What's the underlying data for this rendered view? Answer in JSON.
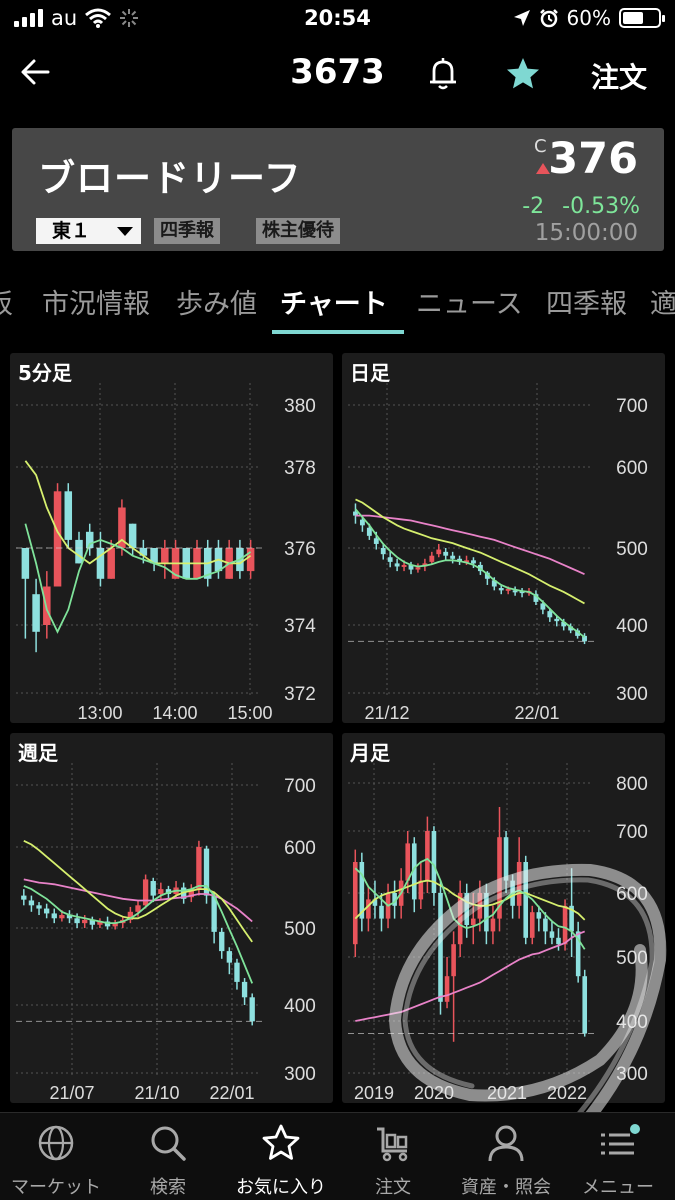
{
  "status_bar": {
    "carrier": "au",
    "time": "20:54",
    "battery": "60%",
    "battery_level": 0.6
  },
  "nav": {
    "code": "3673",
    "order_label": "注文"
  },
  "stock": {
    "name": "ブロードリーフ",
    "market": "東１",
    "tags": [
      "四季報",
      "株主優待"
    ],
    "price_flag": "C",
    "price": "376",
    "change": "-2",
    "change_pct": "-0.53%",
    "time": "15:00:00"
  },
  "tabs": [
    "板",
    "市況情報",
    "歩み値",
    "チャート",
    "ニュース",
    "四季報",
    "適"
  ],
  "active_tab": 3,
  "colors": {
    "accent": "#7fd8d2",
    "up": "#e8545b",
    "down": "#8ee0df",
    "ma_short": "#7fe39a",
    "ma_mid": "#d6ef6e",
    "ma_long": "#e882c8",
    "change": "#7ee69a"
  },
  "chart_data": [
    {
      "type": "candlestick",
      "title": "5分足",
      "y_ticks": [
        380,
        378,
        376,
        374,
        372
      ],
      "ylim": [
        372,
        380
      ],
      "x_ticks": [
        "13:00",
        "14:00",
        "15:00"
      ],
      "last_price": 376,
      "candles": [
        [
          376,
          375.2,
          376,
          373.6
        ],
        [
          374.8,
          373.8,
          375.2,
          373.2
        ],
        [
          374,
          375,
          375.4,
          373.6
        ],
        [
          375,
          377.4,
          377.6,
          375
        ],
        [
          377.4,
          376.2,
          377.6,
          376
        ],
        [
          376.2,
          375.6,
          376.4,
          375.6
        ],
        [
          376.4,
          376,
          376.6,
          375.8
        ],
        [
          376,
          375.2,
          376.4,
          375
        ],
        [
          375.2,
          376,
          376.2,
          375.2
        ],
        [
          376,
          377,
          377.2,
          375.8
        ],
        [
          376.6,
          376,
          376.6,
          375.8
        ],
        [
          376,
          375.8,
          376.2,
          375.6
        ],
        [
          376,
          375.6,
          376,
          375.4
        ],
        [
          375.6,
          376,
          376.2,
          375.2
        ],
        [
          375.2,
          376,
          376.2,
          375.2
        ],
        [
          376,
          375.2,
          376,
          375.2
        ],
        [
          375.2,
          376,
          376.2,
          375.2
        ],
        [
          376,
          375.2,
          376.2,
          375
        ],
        [
          376,
          375.4,
          376.2,
          375.2
        ],
        [
          375.2,
          376,
          376.2,
          375.2
        ],
        [
          376,
          375.4,
          376.2,
          375.2
        ],
        [
          375.4,
          376,
          376.2,
          375.2
        ]
      ],
      "ma": [
        {
          "color": "#d6ef6e",
          "values": [
            378.2,
            377.8,
            377,
            376.4,
            376,
            375.8,
            375.6,
            375.8,
            376,
            376.2,
            376,
            375.8,
            375.6,
            375.6,
            375.6,
            375.6,
            375.6,
            375.6,
            375.7,
            375.6,
            375.6,
            375.8
          ]
        },
        {
          "color": "#7fe39a",
          "values": [
            376.6,
            375.6,
            374.4,
            373.8,
            374.4,
            375.4,
            376.1,
            376.2,
            376.1,
            376,
            375.8,
            375.7,
            375.6,
            375.5,
            375.3,
            375.2,
            375.2,
            375.3,
            375.4,
            375.6,
            375.7,
            375.9
          ]
        }
      ]
    },
    {
      "type": "candlestick",
      "title": "日足",
      "y_ticks": [
        700,
        600,
        500,
        400,
        300
      ],
      "ylim": [
        300,
        700
      ],
      "x_ticks": [
        "21/12",
        "22/01"
      ],
      "last_price": 376,
      "candles": [
        [
          545,
          540,
          555,
          530
        ],
        [
          535,
          528,
          540,
          520
        ],
        [
          525,
          515,
          530,
          510
        ],
        [
          512,
          505,
          520,
          498
        ],
        [
          500,
          492,
          505,
          485
        ],
        [
          488,
          482,
          495,
          475
        ],
        [
          480,
          476,
          486,
          470
        ],
        [
          476,
          478,
          484,
          470
        ],
        [
          478,
          472,
          482,
          466
        ],
        [
          472,
          475,
          480,
          468
        ],
        [
          476,
          480,
          486,
          470
        ],
        [
          482,
          490,
          495,
          478
        ],
        [
          492,
          498,
          505,
          488
        ],
        [
          495,
          490,
          500,
          484
        ],
        [
          490,
          486,
          495,
          480
        ],
        [
          486,
          482,
          490,
          478
        ],
        [
          482,
          484,
          490,
          478
        ],
        [
          484,
          480,
          488,
          474
        ],
        [
          478,
          470,
          482,
          465
        ],
        [
          468,
          460,
          470,
          452
        ],
        [
          458,
          450,
          462,
          445
        ],
        [
          448,
          445,
          452,
          440
        ],
        [
          446,
          447,
          450,
          440
        ],
        [
          445,
          444,
          450,
          438
        ],
        [
          444,
          442,
          448,
          436
        ],
        [
          442,
          444,
          448,
          438
        ],
        [
          440,
          430,
          445,
          426
        ],
        [
          428,
          420,
          432,
          414
        ],
        [
          418,
          410,
          422,
          404
        ],
        [
          408,
          405,
          412,
          398
        ],
        [
          404,
          398,
          408,
          392
        ],
        [
          398,
          392,
          402,
          388
        ],
        [
          392,
          384,
          395,
          380
        ],
        [
          384,
          376,
          388,
          372
        ]
      ],
      "ma": [
        {
          "color": "#e882c8",
          "values": [
            540,
            540,
            540,
            539,
            538,
            537,
            536,
            535,
            534,
            532,
            530,
            528,
            526,
            524,
            522,
            520,
            518,
            516,
            514,
            512,
            510,
            507,
            504,
            501,
            498,
            495,
            492,
            489,
            486,
            482,
            478,
            474,
            470,
            466
          ]
        },
        {
          "color": "#d6ef6e",
          "values": [
            560,
            556,
            550,
            544,
            538,
            533,
            528,
            524,
            521,
            518,
            515,
            512,
            510,
            508,
            506,
            503,
            500,
            497,
            494,
            490,
            486,
            482,
            478,
            474,
            470,
            466,
            461,
            456,
            451,
            447,
            443,
            438,
            433,
            428
          ]
        },
        {
          "color": "#7fe39a",
          "values": [
            548,
            538,
            528,
            516,
            505,
            496,
            488,
            482,
            478,
            476,
            477,
            479,
            482,
            484,
            484,
            483,
            481,
            478,
            473,
            466,
            458,
            452,
            448,
            446,
            444,
            443,
            438,
            430,
            421,
            412,
            404,
            397,
            390,
            382
          ]
        }
      ]
    },
    {
      "type": "candlestick",
      "title": "週足",
      "y_ticks": [
        700,
        600,
        500,
        400,
        300
      ],
      "ylim": [
        300,
        700
      ],
      "x_ticks": [
        "21/07",
        "21/10",
        "22/01"
      ],
      "last_price": 376,
      "candles": [
        [
          540,
          535,
          548,
          528
        ],
        [
          534,
          528,
          540,
          520
        ],
        [
          528,
          524,
          532,
          516
        ],
        [
          524,
          518,
          530,
          512
        ],
        [
          518,
          512,
          524,
          506
        ],
        [
          512,
          516,
          522,
          508
        ],
        [
          516,
          512,
          522,
          506
        ],
        [
          512,
          506,
          518,
          500
        ],
        [
          506,
          510,
          516,
          500
        ],
        [
          510,
          504,
          514,
          498
        ],
        [
          504,
          508,
          512,
          500
        ],
        [
          508,
          502,
          514,
          498
        ],
        [
          502,
          506,
          510,
          498
        ],
        [
          506,
          510,
          514,
          500
        ],
        [
          510,
          520,
          526,
          506
        ],
        [
          520,
          528,
          534,
          514
        ],
        [
          528,
          560,
          566,
          524
        ],
        [
          558,
          540,
          562,
          532
        ],
        [
          542,
          548,
          556,
          536
        ],
        [
          548,
          542,
          552,
          536
        ],
        [
          542,
          550,
          558,
          538
        ],
        [
          550,
          536,
          556,
          530
        ],
        [
          538,
          548,
          554,
          532
        ],
        [
          548,
          600,
          610,
          540
        ],
        [
          598,
          540,
          602,
          530
        ],
        [
          540,
          495,
          545,
          480
        ],
        [
          495,
          470,
          500,
          460
        ],
        [
          470,
          455,
          475,
          440
        ],
        [
          455,
          430,
          460,
          420
        ],
        [
          430,
          410,
          435,
          400
        ],
        [
          410,
          376,
          415,
          370
        ]
      ],
      "ma": [
        {
          "color": "#e882c8",
          "values": [
            560,
            558,
            556,
            555,
            554,
            552,
            550,
            548,
            546,
            544,
            542,
            540,
            538,
            536,
            535,
            534,
            534,
            534,
            535,
            536,
            537,
            538,
            540,
            542,
            542,
            540,
            536,
            530,
            524,
            516,
            508
          ]
        },
        {
          "color": "#d6ef6e",
          "values": [
            610,
            604,
            596,
            588,
            580,
            572,
            564,
            556,
            548,
            540,
            532,
            524,
            518,
            514,
            512,
            512,
            516,
            522,
            528,
            534,
            540,
            544,
            546,
            548,
            548,
            544,
            536,
            524,
            510,
            496,
            482
          ]
        },
        {
          "color": "#7fe39a",
          "values": [
            552,
            548,
            542,
            536,
            528,
            520,
            516,
            514,
            512,
            510,
            508,
            506,
            506,
            508,
            512,
            518,
            526,
            534,
            540,
            544,
            546,
            546,
            548,
            552,
            552,
            540,
            520,
            498,
            476,
            452,
            428
          ]
        }
      ]
    },
    {
      "type": "candlestick",
      "title": "月足",
      "y_ticks": [
        800,
        700,
        600,
        500,
        400,
        300
      ],
      "ylim": [
        300,
        800
      ],
      "x_ticks": [
        "2019",
        "2020",
        "2021",
        "2022"
      ],
      "last_price": 376,
      "candles": [
        [
          520,
          650,
          670,
          500
        ],
        [
          650,
          560,
          665,
          540
        ],
        [
          560,
          590,
          610,
          540
        ],
        [
          590,
          580,
          620,
          560
        ],
        [
          580,
          560,
          600,
          540
        ],
        [
          560,
          600,
          615,
          545
        ],
        [
          600,
          580,
          620,
          560
        ],
        [
          580,
          620,
          640,
          560
        ],
        [
          620,
          680,
          700,
          600
        ],
        [
          680,
          590,
          690,
          570
        ],
        [
          590,
          620,
          650,
          575
        ],
        [
          620,
          700,
          730,
          600
        ],
        [
          700,
          600,
          710,
          580
        ],
        [
          600,
          430,
          620,
          410
        ],
        [
          430,
          470,
          500,
          420
        ],
        [
          470,
          520,
          540,
          360
        ],
        [
          520,
          600,
          620,
          500
        ],
        [
          600,
          550,
          615,
          530
        ],
        [
          550,
          560,
          600,
          520
        ],
        [
          560,
          600,
          620,
          540
        ],
        [
          600,
          540,
          615,
          520
        ],
        [
          540,
          560,
          580,
          520
        ],
        [
          560,
          690,
          750,
          540
        ],
        [
          690,
          620,
          700,
          600
        ],
        [
          620,
          580,
          630,
          560
        ],
        [
          580,
          650,
          690,
          560
        ],
        [
          650,
          530,
          660,
          520
        ],
        [
          530,
          570,
          580,
          520
        ],
        [
          570,
          560,
          580,
          540
        ],
        [
          560,
          540,
          570,
          520
        ],
        [
          540,
          530,
          555,
          520
        ],
        [
          530,
          520,
          545,
          510
        ],
        [
          520,
          580,
          590,
          510
        ],
        [
          580,
          540,
          640,
          500
        ],
        [
          540,
          470,
          555,
          460
        ],
        [
          470,
          376,
          480,
          370
        ]
      ],
      "ma": [
        {
          "color": "#e882c8",
          "values": [
            400,
            402,
            404,
            406,
            408,
            410,
            412,
            414,
            418,
            422,
            426,
            430,
            434,
            438,
            440,
            444,
            448,
            452,
            456,
            460,
            466,
            472,
            478,
            484,
            490,
            496,
            500,
            504,
            506,
            510,
            514,
            518,
            522,
            530,
            536,
            540
          ]
        },
        {
          "color": "#d6ef6e",
          "values": [
            560,
            570,
            580,
            590,
            596,
            600,
            602,
            606,
            610,
            614,
            618,
            620,
            618,
            612,
            606,
            598,
            592,
            586,
            582,
            580,
            580,
            582,
            586,
            590,
            596,
            600,
            600,
            596,
            592,
            588,
            584,
            580,
            578,
            574,
            568,
            558
          ]
        },
        {
          "color": "#7fe39a",
          "values": [
            640,
            630,
            610,
            600,
            590,
            580,
            586,
            600,
            620,
            640,
            650,
            655,
            645,
            620,
            590,
            560,
            550,
            545,
            548,
            552,
            560,
            566,
            580,
            592,
            600,
            604,
            598,
            590,
            578,
            566,
            556,
            548,
            546,
            540,
            528,
            512
          ]
        }
      ]
    }
  ],
  "bottom_tabs": [
    {
      "label": "マーケット",
      "icon": "globe-icon"
    },
    {
      "label": "検索",
      "icon": "search-icon"
    },
    {
      "label": "お気に入り",
      "icon": "star-icon"
    },
    {
      "label": "注文",
      "icon": "cart-icon"
    },
    {
      "label": "資産・照会",
      "icon": "person-icon"
    },
    {
      "label": "メニュー",
      "icon": "menu-icon"
    }
  ],
  "active_bottom_tab": 2
}
